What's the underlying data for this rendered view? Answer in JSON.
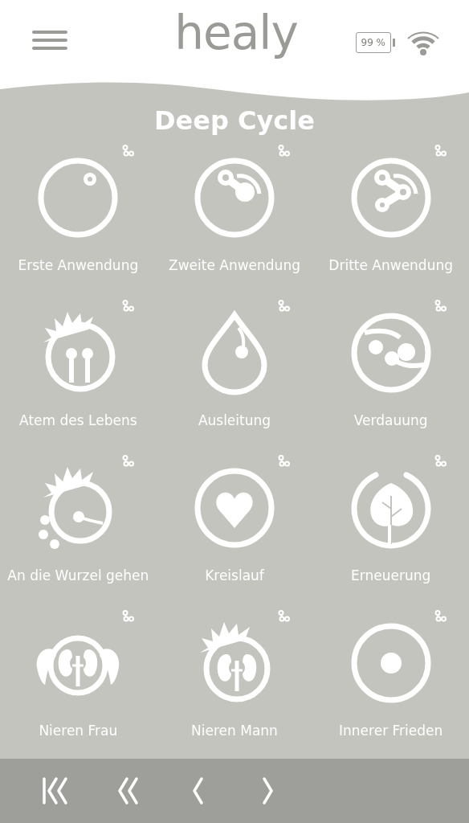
{
  "header": {
    "logo": "healy",
    "battery": "99 %"
  },
  "title": "Deep Cycle",
  "tiles": [
    {
      "label": "Erste Anwendung",
      "kind": "ring-dot"
    },
    {
      "label": "Zweite Anwendung",
      "kind": "ring-two"
    },
    {
      "label": "Dritte Anwendung",
      "kind": "ring-three"
    },
    {
      "label": "Atem des Lebens",
      "kind": "spiky-lungs"
    },
    {
      "label": "Ausleitung",
      "kind": "drop"
    },
    {
      "label": "Verdauung",
      "kind": "digestion"
    },
    {
      "label": "An die Wurzel gehen",
      "kind": "spiky-root"
    },
    {
      "label": "Kreislauf",
      "kind": "heart"
    },
    {
      "label": "Erneuerung",
      "kind": "leaf"
    },
    {
      "label": "Nieren Frau",
      "kind": "kidneys-pigtails"
    },
    {
      "label": "Nieren Mann",
      "kind": "kidneys-spiky"
    },
    {
      "label": "Innerer Frieden",
      "kind": "ring-center"
    }
  ]
}
